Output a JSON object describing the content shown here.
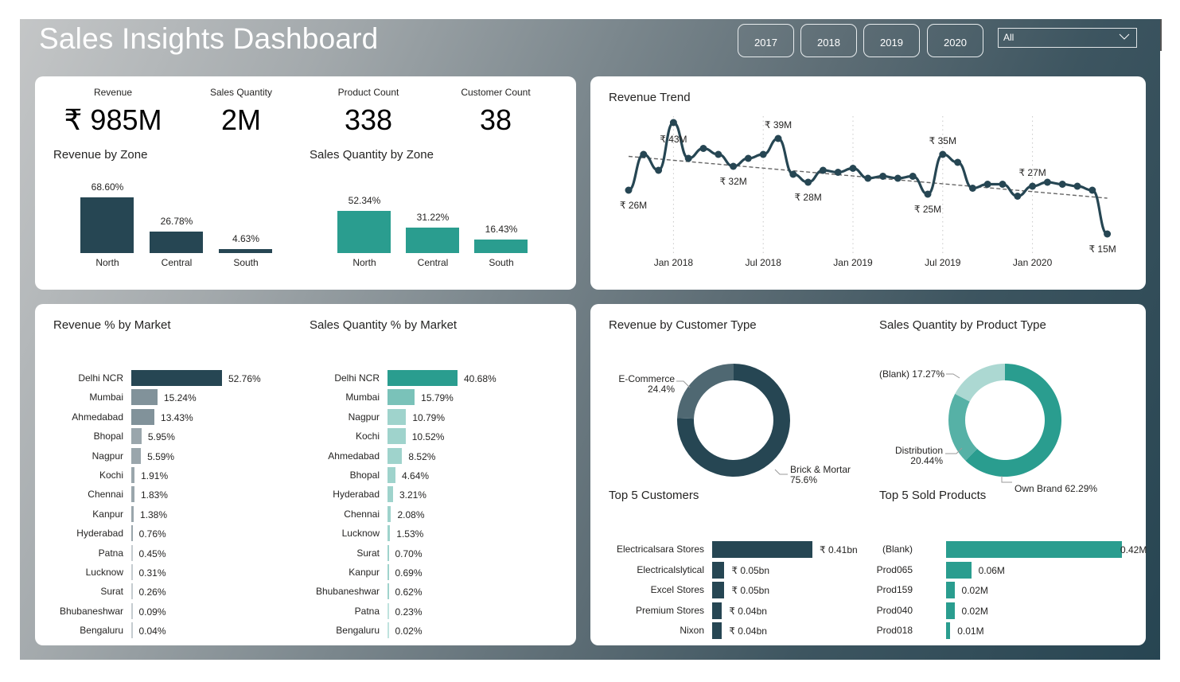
{
  "header": {
    "title": "Sales Insights Dashboard",
    "year_buttons": [
      "2017",
      "2018",
      "2019",
      "2020"
    ],
    "dropdown": {
      "selected": "All",
      "icon": "chevron-down-icon"
    }
  },
  "colors": {
    "navy": "#264653",
    "teal": "#2a9d8f",
    "navy_light": "#81929a",
    "navy_lighter": "#9aa6ac",
    "teal_light": "#7ac2b9",
    "teal_lighter": "#9fd3cc",
    "ecommerce": "#4f6872",
    "blank_product": "#acd8d2",
    "distribution": "#56b1a6"
  },
  "kpis": [
    {
      "label": "Revenue",
      "value": "₹ 985M"
    },
    {
      "label": "Sales Quantity",
      "value": "2M"
    },
    {
      "label": "Product Count",
      "value": "338"
    },
    {
      "label": "Customer Count",
      "value": "38"
    }
  ],
  "chart_data": [
    {
      "id": "revenue-by-zone",
      "type": "bar",
      "title": "Revenue by Zone",
      "categories": [
        "North",
        "Central",
        "South"
      ],
      "values": [
        68.6,
        26.78,
        4.63
      ],
      "labels": [
        "68.60%",
        "26.78%",
        "4.63%"
      ],
      "unit": "%"
    },
    {
      "id": "sales-qty-by-zone",
      "type": "bar",
      "title": "Sales Quantity by Zone",
      "categories": [
        "North",
        "Central",
        "South"
      ],
      "values": [
        52.34,
        31.22,
        16.43
      ],
      "labels": [
        "52.34%",
        "31.22%",
        "16.43%"
      ],
      "unit": "%"
    },
    {
      "id": "revenue-trend",
      "type": "line",
      "title": "Revenue Trend",
      "x_tick_labels": [
        "Jan 2018",
        "Jul 2018",
        "Jan 2019",
        "Jul 2019",
        "Jan 2020"
      ],
      "x_tick_index": [
        3,
        9,
        15,
        21,
        27
      ],
      "values": [
        26,
        35,
        31,
        43,
        34,
        36.5,
        35,
        32,
        34,
        35,
        39,
        30,
        28,
        31,
        30.5,
        31.5,
        29,
        29.5,
        29,
        29.5,
        25,
        35,
        33,
        26.5,
        27.5,
        27.5,
        24.5,
        27,
        28,
        27.5,
        27,
        26,
        15
      ],
      "annotations": [
        {
          "index": 0,
          "label": "₹ 26M",
          "pos": "below"
        },
        {
          "index": 3,
          "label": "₹ 43M",
          "pos": "below-left"
        },
        {
          "index": 7,
          "label": "₹ 32M",
          "pos": "below"
        },
        {
          "index": 10,
          "label": "₹ 39M",
          "pos": "above"
        },
        {
          "index": 12,
          "label": "₹ 28M",
          "pos": "below"
        },
        {
          "index": 20,
          "label": "₹ 25M",
          "pos": "below"
        },
        {
          "index": 21,
          "label": "₹ 35M",
          "pos": "above"
        },
        {
          "index": 27,
          "label": "₹ 27M",
          "pos": "above"
        },
        {
          "index": 32,
          "label": "₹ 15M",
          "pos": "below"
        }
      ],
      "trendline": {
        "start": 34.5,
        "end": 24.0,
        "style": "dashed"
      },
      "ylim": [
        10,
        45
      ],
      "grid": "vertical-dotted"
    },
    {
      "id": "revenue-pct-by-market",
      "type": "bar",
      "orientation": "horizontal",
      "title": "Revenue % by Market",
      "categories": [
        "Delhi NCR",
        "Mumbai",
        "Ahmedabad",
        "Bhopal",
        "Nagpur",
        "Kochi",
        "Chennai",
        "Kanpur",
        "Hyderabad",
        "Patna",
        "Lucknow",
        "Surat",
        "Bhubaneshwar",
        "Bengaluru"
      ],
      "values": [
        52.76,
        15.24,
        13.43,
        5.95,
        5.59,
        1.91,
        1.83,
        1.38,
        0.76,
        0.45,
        0.31,
        0.26,
        0.09,
        0.04
      ],
      "labels": [
        "52.76%",
        "15.24%",
        "13.43%",
        "5.95%",
        "5.59%",
        "1.91%",
        "1.83%",
        "1.38%",
        "0.76%",
        "0.45%",
        "0.31%",
        "0.26%",
        "0.09%",
        "0.04%"
      ]
    },
    {
      "id": "sales-qty-pct-by-market",
      "type": "bar",
      "orientation": "horizontal",
      "title": "Sales Quantity % by Market",
      "categories": [
        "Delhi NCR",
        "Mumbai",
        "Nagpur",
        "Kochi",
        "Ahmedabad",
        "Bhopal",
        "Hyderabad",
        "Chennai",
        "Lucknow",
        "Surat",
        "Kanpur",
        "Bhubaneshwar",
        "Patna",
        "Bengaluru"
      ],
      "values": [
        40.68,
        15.79,
        10.79,
        10.52,
        8.52,
        4.64,
        3.21,
        2.08,
        1.53,
        0.7,
        0.69,
        0.62,
        0.23,
        0.02
      ],
      "labels": [
        "40.68%",
        "15.79%",
        "10.79%",
        "10.52%",
        "8.52%",
        "4.64%",
        "3.21%",
        "2.08%",
        "1.53%",
        "0.70%",
        "0.69%",
        "0.62%",
        "0.23%",
        "0.02%"
      ]
    },
    {
      "id": "revenue-by-customer-type",
      "type": "pie",
      "donut": true,
      "title": "Revenue by Customer Type",
      "categories": [
        "Brick & Mortar",
        "E-Commerce"
      ],
      "values": [
        75.6,
        24.4
      ],
      "labels": [
        "Brick & Mortar\n75.6%",
        "E-Commerce\n24.4%"
      ]
    },
    {
      "id": "sales-qty-by-product-type",
      "type": "pie",
      "donut": true,
      "title": "Sales Quantity by Product Type",
      "categories": [
        "Own Brand",
        "Distribution",
        "(Blank)"
      ],
      "values": [
        62.29,
        20.44,
        17.27
      ],
      "labels": [
        "Own Brand 62.29%",
        "Distribution\n20.44%",
        "(Blank) 17.27%"
      ]
    },
    {
      "id": "top-5-customers",
      "type": "bar",
      "orientation": "horizontal",
      "title": "Top 5 Customers",
      "categories": [
        "Electricalsara Stores",
        "Electricalslytical",
        "Excel Stores",
        "Premium Stores",
        "Nixon"
      ],
      "values": [
        0.41,
        0.05,
        0.05,
        0.04,
        0.04
      ],
      "labels": [
        "₹ 0.41bn",
        "₹ 0.05bn",
        "₹ 0.05bn",
        "₹ 0.04bn",
        "₹ 0.04bn"
      ],
      "unit": "bn INR"
    },
    {
      "id": "top-5-sold-products",
      "type": "bar",
      "orientation": "horizontal",
      "title": "Top 5 Sold Products",
      "categories": [
        "(Blank)",
        "Prod065",
        "Prod159",
        "Prod040",
        "Prod018"
      ],
      "values": [
        0.42,
        0.06,
        0.02,
        0.02,
        0.01
      ],
      "labels": [
        "0.42M",
        "0.06M",
        "0.02M",
        "0.02M",
        "0.01M"
      ],
      "unit": "M units"
    }
  ]
}
